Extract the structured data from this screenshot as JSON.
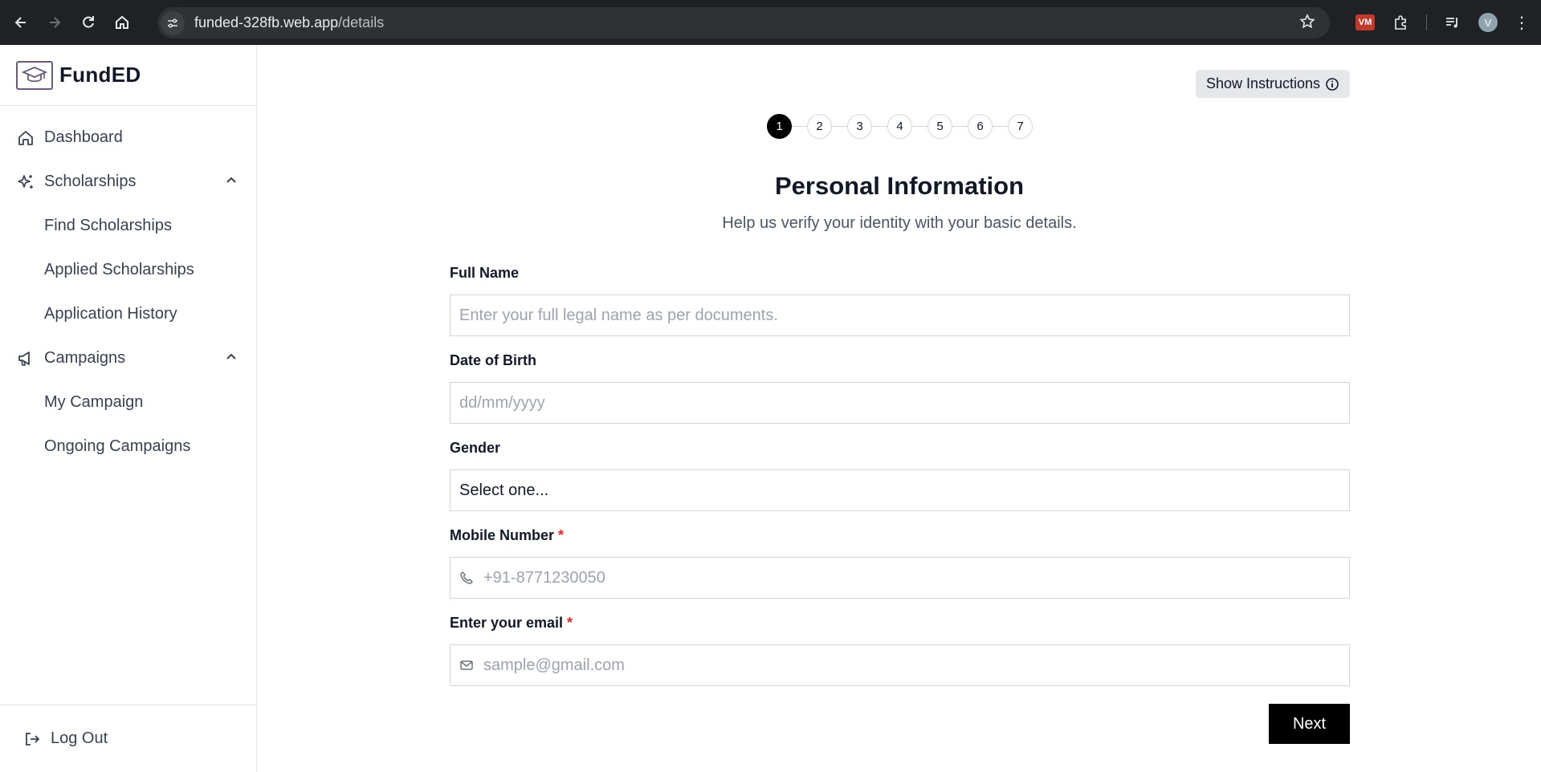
{
  "browser": {
    "url_host": "funded-328fb.web.app",
    "url_path": "/details",
    "profile_initial": "V",
    "extension_badge": "VM"
  },
  "sidebar": {
    "brand_name": "FundED",
    "items": [
      {
        "label": "Dashboard",
        "icon": "home-icon"
      },
      {
        "label": "Scholarships",
        "icon": "sparkles-icon",
        "expanded": true,
        "children": [
          "Find Scholarships",
          "Applied Scholarships",
          "Application History"
        ]
      },
      {
        "label": "Campaigns",
        "icon": "megaphone-icon",
        "expanded": true,
        "children": [
          "My Campaign",
          "Ongoing Campaigns"
        ]
      }
    ],
    "logout_label": "Log Out"
  },
  "main": {
    "instructions_label": "Show Instructions",
    "steps": [
      "1",
      "2",
      "3",
      "4",
      "5",
      "6",
      "7"
    ],
    "active_step": 1,
    "title": "Personal Information",
    "subtitle": "Help us verify your identity with your basic details.",
    "fields": {
      "full_name": {
        "label": "Full Name",
        "placeholder": "Enter your full legal name as per documents."
      },
      "dob": {
        "label": "Date of Birth",
        "placeholder": "dd/mm/yyyy"
      },
      "gender": {
        "label": "Gender",
        "value": "Select one..."
      },
      "mobile": {
        "label": "Mobile Number",
        "required": "*",
        "placeholder": "+91-8771230050"
      },
      "email": {
        "label": "Enter your email",
        "required": "*",
        "placeholder": "sample@gmail.com"
      }
    },
    "next_label": "Next"
  }
}
